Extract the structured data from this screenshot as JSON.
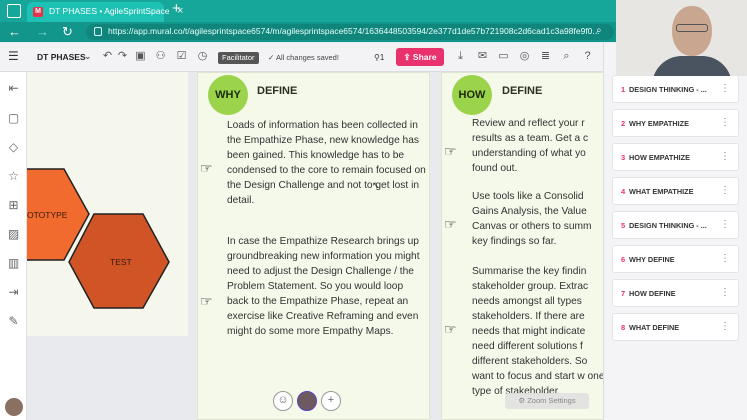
{
  "browser": {
    "tab_title": "DT PHASES • AgileSprintSpace",
    "tab_favicon": "M",
    "url": "https://app.mural.co/t/agilesprintspace6574/m/agilesprintspace6574/1636448503594/2e377d1de57b721908c2d6cad1c3a98fe9f0...",
    "new_tab": "+",
    "close_tab": "×"
  },
  "toolbar": {
    "mural_name": "DT PHASES",
    "facilitator_label": "Facilitator",
    "saved_status": "All changes saved!",
    "users_count": "1",
    "share_label": "Share"
  },
  "canvas": {
    "hexagons": [
      {
        "label": "OTOTYPE",
        "color": "#f26b2e"
      },
      {
        "label": "TEST",
        "color": "#d05425"
      }
    ],
    "panels": [
      {
        "badge": "WHY",
        "heading": "DEFINE",
        "paragraphs": [
          "Loads of information has been collected in the Empathize Phase, new knowledge has been gained. This knowledge has to be condensed to the core to remain focused on the Design Challenge and not to get lost in detail.",
          "In case the Empathize Research brings up groundbreaking new information you might need to adjust the Design Challenge / the Problem Statement. So you would loop back to the Empathize Phase, repeat an exercise like Creative Reframing and even might do some more Empathy Maps."
        ]
      },
      {
        "badge": "HOW",
        "heading": "DEFINE",
        "paragraphs": [
          "Review and reflect your r results as a team. Get a c understanding of what yo found out.",
          "Use tools like a Consolid Gains Analysis, the Value Canvas or others to summ key findings so far.",
          "Summarise the key findin stakeholder group. Extrac needs amongst all types stakeholders. If there are needs that might indicate need different solutions f different stakeholders. So want to focus and start w one type of stakeholder."
        ]
      }
    ],
    "zoom_settings": "Zoom Settings",
    "add_collaborator": "+"
  },
  "outline": {
    "items": [
      {
        "num": "1",
        "label": "DESIGN THINKING - ..."
      },
      {
        "num": "2",
        "label": "WHY EMPATHIZE"
      },
      {
        "num": "3",
        "label": "HOW EMPATHIZE"
      },
      {
        "num": "4",
        "label": "WHAT EMPATHIZE"
      },
      {
        "num": "5",
        "label": "DESIGN THINKING - ..."
      },
      {
        "num": "6",
        "label": "WHY DEFINE"
      },
      {
        "num": "7",
        "label": "HOW DEFINE"
      },
      {
        "num": "8",
        "label": "WHAT DEFINE"
      }
    ]
  },
  "colors": {
    "browser_teal": "#16a69a",
    "share_pink": "#e8316d",
    "badge_green": "#9bd34a",
    "panel_bg": "#f4f9ea"
  }
}
